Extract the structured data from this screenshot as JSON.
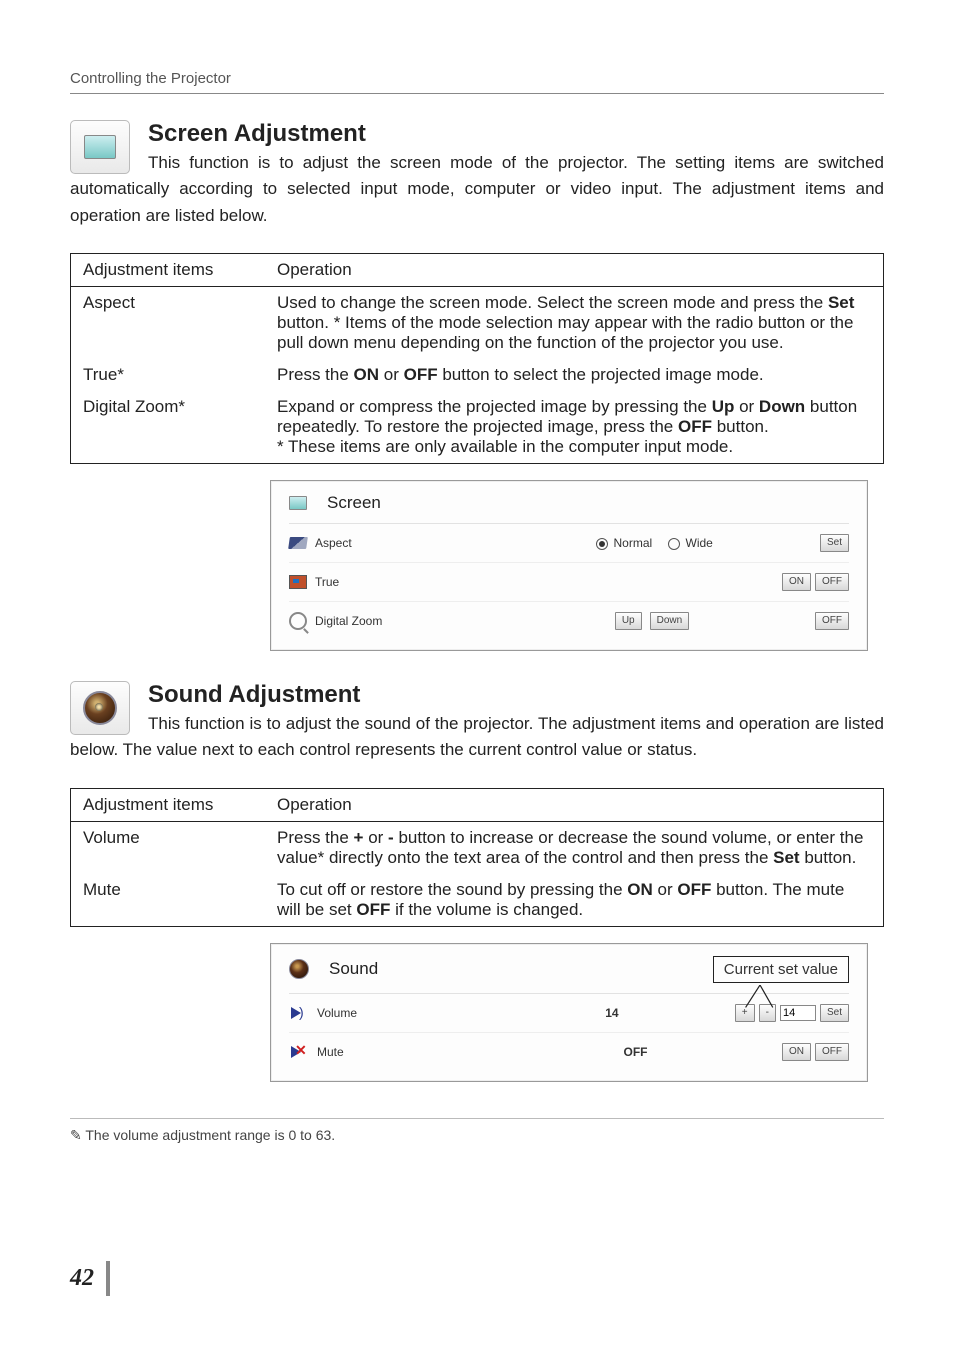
{
  "header": "Controlling the Projector",
  "page_number": "42",
  "footnote_icon": "✎",
  "footnote": " The volume adjustment range is 0 to 63.",
  "callout_label": "Current set value",
  "screen": {
    "title": "Screen Adjustment",
    "intro": "This function is to adjust the screen mode of the projector. The setting items are switched automatically according to selected input mode, computer or video input. The adjustment items and operation are listed below.",
    "tbl": {
      "h1": "Adjustment items",
      "h2": "Operation",
      "rows": [
        {
          "item": "Aspect",
          "op_pre": "Used to change the screen mode. Select the screen mode and press the ",
          "b1": "Set",
          "op_post": " button. * Items of the mode selection may appear with the radio button or the pull down menu depending on the function of the projector you use."
        },
        {
          "item": "True*",
          "op_pre": "Press the ",
          "b1": "ON",
          "mid1": " or ",
          "b2": "OFF",
          "op_post": " button to select the projected image mode."
        },
        {
          "item": "Digital Zoom*",
          "op_pre": "Expand or compress the projected image by pressing the ",
          "b1": "Up",
          "mid1": " or ",
          "b2": "Down",
          "mid2": " button repeatedly. To restore the projected image, press the ",
          "b3": "OFF",
          "op_post": " button.",
          "tail": "* These items are only available in the computer input mode."
        }
      ]
    },
    "panel": {
      "title": "Screen",
      "rows": {
        "aspect": {
          "label": "Aspect",
          "opt1": "Normal",
          "opt2": "Wide",
          "set": "Set"
        },
        "true": {
          "label": "True",
          "on": "ON",
          "off": "OFF"
        },
        "dz": {
          "label": "Digital Zoom",
          "up": "Up",
          "down": "Down",
          "off": "OFF"
        }
      }
    }
  },
  "sound": {
    "title": "Sound Adjustment",
    "intro": "This function is to adjust the sound of the projector. The adjustment items and operation are listed below. The value next to each control represents the current control value or status.",
    "tbl": {
      "h1": "Adjustment items",
      "h2": "Operation",
      "rows": [
        {
          "item": "Volume",
          "op_pre": "Press the ",
          "b1": "+",
          "mid1": " or ",
          "b2": "-",
          "mid2": " button to increase or decrease the sound volume, or enter the value* directly onto the text area of the control and then press the ",
          "b3": "Set",
          "op_post": " button."
        },
        {
          "item": "Mute",
          "op_pre": "To cut off or restore the sound by pressing the ",
          "b1": "ON",
          "mid1": " or ",
          "b2": "OFF",
          "mid2": " button. The mute will be set ",
          "b3": "OFF",
          "op_post": " if the volume is changed."
        }
      ]
    },
    "panel": {
      "title": "Sound",
      "rows": {
        "volume": {
          "label": "Volume",
          "value": "14",
          "plus": "+",
          "minus": "-",
          "input": "14",
          "set": "Set"
        },
        "mute": {
          "label": "Mute",
          "value": "OFF",
          "on": "ON",
          "off": "OFF"
        }
      }
    }
  }
}
